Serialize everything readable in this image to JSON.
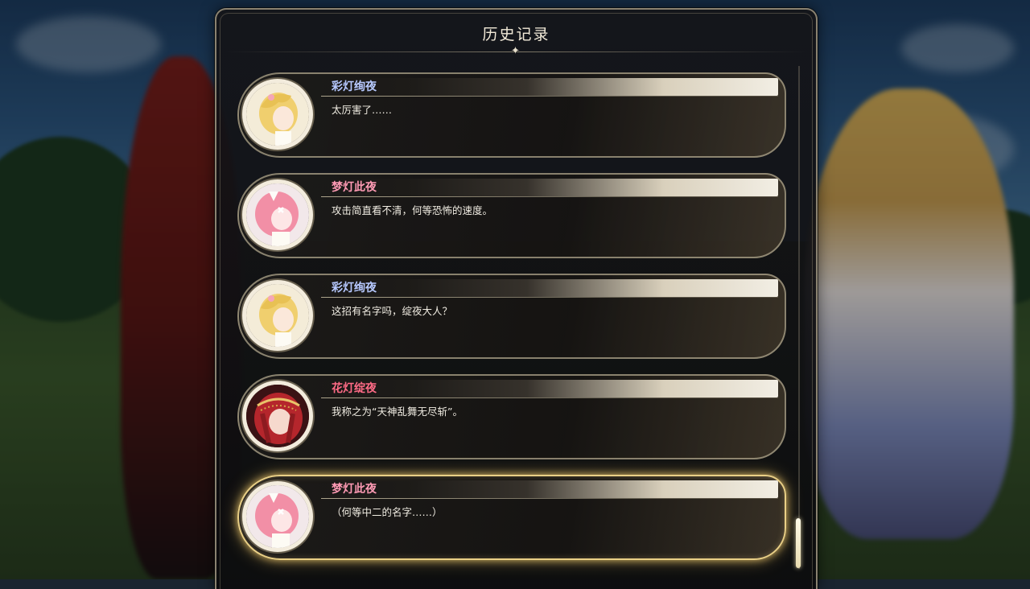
{
  "panel": {
    "title": "历史记录"
  },
  "entries": [
    {
      "speaker": "彩灯绚夜",
      "text": "太厉害了……",
      "name_color": "#b7c9ff",
      "avatar": "blonde-girl-portrait-icon",
      "active": false
    },
    {
      "speaker": "梦灯此夜",
      "text": "攻击简直看不清，何等恐怖的速度。",
      "name_color": "#ff9bb5",
      "avatar": "pink-hair-girl-portrait-icon",
      "active": false
    },
    {
      "speaker": "彩灯绚夜",
      "text": "这招有名字吗，绽夜大人？",
      "name_color": "#b7c9ff",
      "avatar": "blonde-girl-portrait-icon",
      "active": false
    },
    {
      "speaker": "花灯绽夜",
      "text": "我称之为“天神乱舞无尽斩”。",
      "name_color": "#ff6b86",
      "avatar": "red-hair-woman-portrait-icon",
      "active": false
    },
    {
      "speaker": "梦灯此夜",
      "text": "（何等中二的名字……）",
      "name_color": "#ff9bb5",
      "avatar": "pink-hair-girl-portrait-icon",
      "active": true
    }
  ],
  "colors": {
    "accent_gold": "#e9cf86",
    "panel_border": "#8a8270"
  }
}
